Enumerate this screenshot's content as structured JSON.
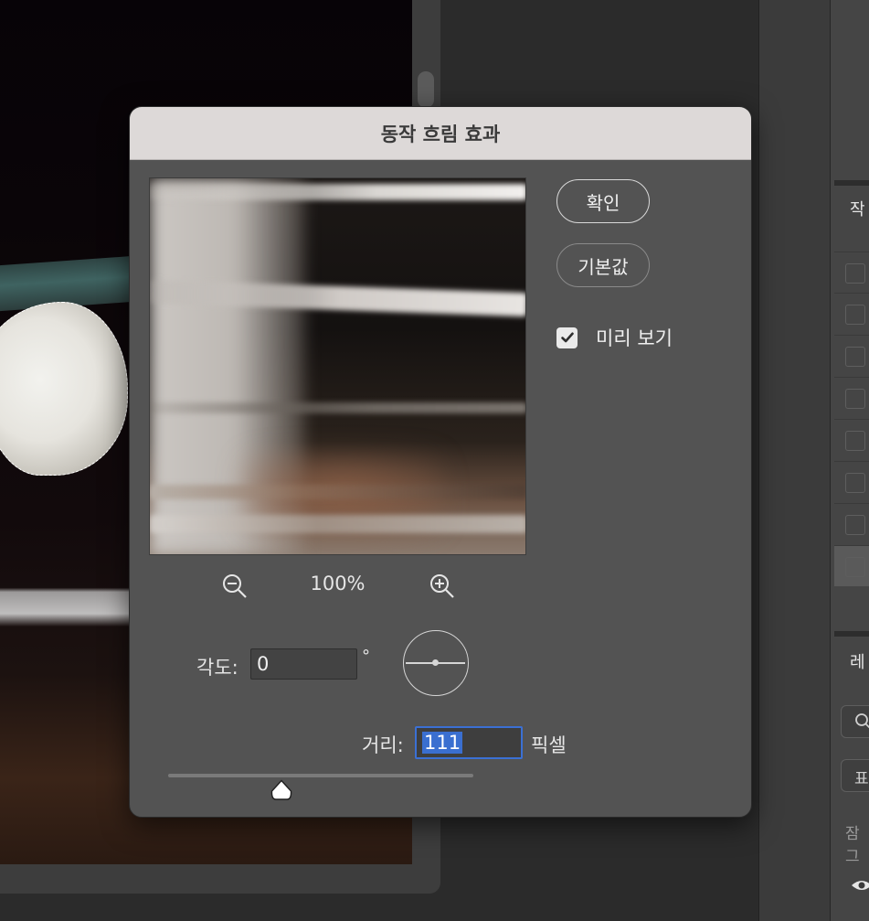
{
  "dialog": {
    "title": "동작 흐림 효과",
    "ok_label": "확인",
    "default_label": "기본값",
    "preview_label": "미리 보기",
    "preview_checked": true
  },
  "zoom": {
    "level": "100%"
  },
  "angle": {
    "label": "각도:",
    "value": "0",
    "unit": "°"
  },
  "distance": {
    "label": "거리:",
    "value": "111",
    "unit": "픽셀",
    "slider_fraction": 0.37
  },
  "side_panel": {
    "label_1": "작",
    "label_2": "레",
    "label_3": "표",
    "label_4": "잠그"
  },
  "icons": [
    "zoom-out-icon",
    "zoom-in-icon",
    "checkmark-icon",
    "angle-dial-icon",
    "slider-thumb-icon",
    "search-icon",
    "eye-icon"
  ],
  "colors": {
    "accent": "#3b70d4",
    "dialog_bg": "#535353",
    "titlebar_bg": "#ddd9d8"
  }
}
